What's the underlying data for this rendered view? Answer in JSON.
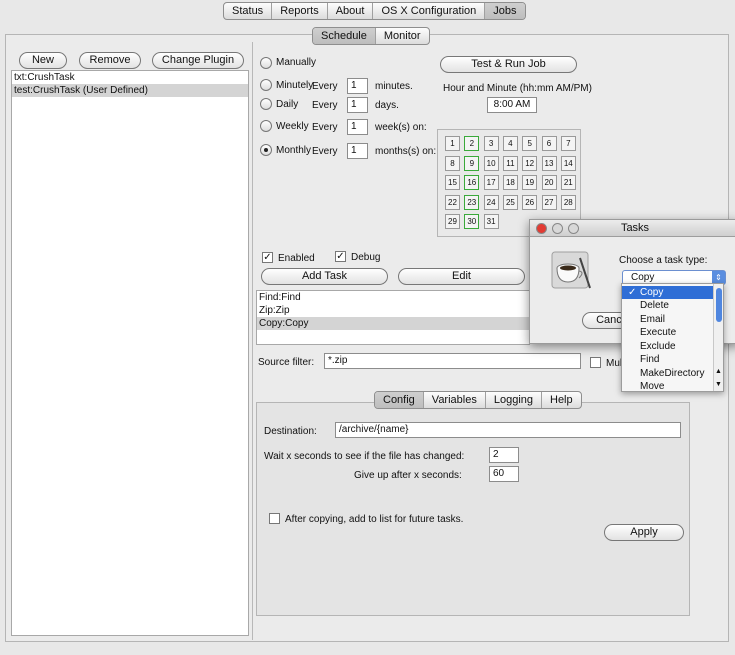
{
  "top_tabs": [
    "Status",
    "Reports",
    "About",
    "OS X Configuration",
    "Jobs"
  ],
  "sub_tabs": [
    "Schedule",
    "Monitor"
  ],
  "left": {
    "new_label": "New",
    "remove_label": "Remove",
    "change_plugin_label": "Change Plugin",
    "jobs": [
      "txt:CrushTask",
      "test:CrushTask (User Defined)"
    ]
  },
  "schedule": {
    "manually": "Manually",
    "minutely": "Minutely",
    "daily": "Daily",
    "weekly": "Weekly",
    "monthly": "Monthly",
    "every": "Every",
    "minutely_value": "1",
    "daily_value": "1",
    "weekly_value": "1",
    "monthly_value": "1",
    "minutes_unit": "minutes.",
    "days_unit": "days.",
    "weeks_unit": "week(s) on:",
    "months_unit": "months(s) on:",
    "test_run_label": "Test & Run Job",
    "time_label": "Hour and Minute (hh:mm AM/PM)",
    "time_value": "8:00 AM",
    "days": [
      "1",
      "2",
      "3",
      "4",
      "5",
      "6",
      "7",
      "8",
      "9",
      "10",
      "11",
      "12",
      "13",
      "14",
      "15",
      "16",
      "17",
      "18",
      "19",
      "20",
      "21",
      "22",
      "23",
      "24",
      "25",
      "26",
      "27",
      "28",
      "29",
      "30",
      "31"
    ]
  },
  "tasks_area": {
    "enabled_label": "Enabled",
    "debug_label": "Debug",
    "add_task_label": "Add Task",
    "edit_label": "Edit",
    "tasks": [
      "Find:Find",
      "Zip:Zip",
      "Copy:Copy"
    ],
    "source_filter_label": "Source filter:",
    "source_filter_value": "*.zip",
    "multi_label": "Mul"
  },
  "config_tabs": [
    "Config",
    "Variables",
    "Logging",
    "Help"
  ],
  "config": {
    "destination_label": "Destination:",
    "destination_value": "/archive/{name}",
    "wait_label": "Wait x seconds to see if the file has changed:",
    "wait_value": "2",
    "giveup_label": "Give up after x seconds:",
    "giveup_value": "60",
    "after_copy_label": "After copying, add to list for future tasks.",
    "apply_label": "Apply"
  },
  "dialog": {
    "title": "Tasks",
    "prompt": "Choose a task type:",
    "selected": "Copy",
    "cancel_label": "Cance",
    "options": [
      "Copy",
      "Delete",
      "Email",
      "Execute",
      "Exclude",
      "Find",
      "MakeDirectory",
      "Move"
    ],
    "check_mark": "✓"
  },
  "colors": {
    "highlight": "#2f6ed6",
    "day_marked": "#3aa93a"
  }
}
